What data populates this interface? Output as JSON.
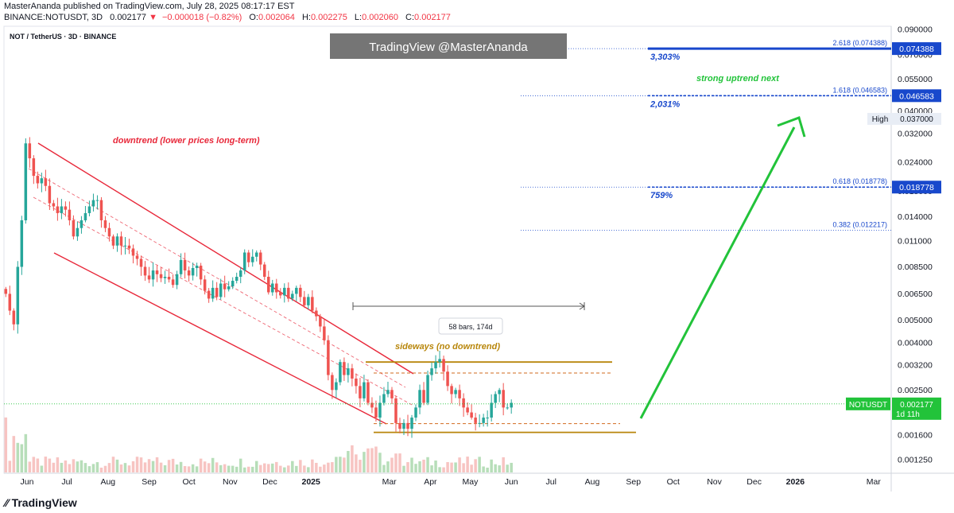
{
  "header": {
    "published": "MasterAnanda published on TradingView.com, July 28, 2025 08:17:17 EST",
    "symbol": "BINANCE:NOTUSDT, 3D",
    "last": "0.002177",
    "change": "−0.000018 (−0.82%)",
    "o_label": "O:",
    "o_value": "0.002064",
    "h_label": "H:",
    "h_value": "0.002275",
    "l_label": "L:",
    "l_value": "0.002060",
    "c_label": "C:",
    "c_value": "0.002177"
  },
  "footer": {
    "brand": "TradingView"
  },
  "colors": {
    "up": "#26a69a",
    "down": "#ef5350",
    "fib": "#1848cc",
    "gold": "#b8860b",
    "green_arrow": "#22c33a",
    "channel": "#e8283a"
  },
  "chart_data": {
    "type": "candlestick",
    "title": "NOT / TetherUS · 3D · BINANCE",
    "watermark": "TradingView @MasterAnanda",
    "y_scale": "log",
    "ylim": [
      0.00113,
      0.09
    ],
    "y_ticks": [
      "0.090000",
      "0.070000",
      "0.055000",
      "0.040000",
      "0.032000",
      "0.024000",
      "0.018000",
      "0.014000",
      "0.011000",
      "0.008500",
      "0.006500",
      "0.005000",
      "0.004000",
      "0.003200",
      "0.002500",
      "0.001600",
      "0.001250"
    ],
    "y_tick_values": [
      0.09,
      0.07,
      0.055,
      0.04,
      0.032,
      0.024,
      0.018,
      0.014,
      0.011,
      0.0085,
      0.0065,
      0.005,
      0.004,
      0.0032,
      0.0025,
      0.0016,
      0.00125
    ],
    "x_ticks": [
      {
        "label": "Jun",
        "date": "2024-06-01",
        "bold": false
      },
      {
        "label": "Jul",
        "date": "2024-07-01",
        "bold": false
      },
      {
        "label": "Aug",
        "date": "2024-08-01",
        "bold": false
      },
      {
        "label": "Sep",
        "date": "2024-09-01",
        "bold": false
      },
      {
        "label": "Oct",
        "date": "2024-10-01",
        "bold": false
      },
      {
        "label": "Nov",
        "date": "2024-11-01",
        "bold": false
      },
      {
        "label": "Dec",
        "date": "2024-12-01",
        "bold": false
      },
      {
        "label": "2025",
        "date": "2025-01-01",
        "bold": true
      },
      {
        "label": "Mar",
        "date": "2025-03-01",
        "bold": false
      },
      {
        "label": "Apr",
        "date": "2025-04-01",
        "bold": false
      },
      {
        "label": "May",
        "date": "2025-05-01",
        "bold": false
      },
      {
        "label": "Jun",
        "date": "2025-06-01",
        "bold": false
      },
      {
        "label": "Jul",
        "date": "2025-07-01",
        "bold": false
      },
      {
        "label": "Aug",
        "date": "2025-08-01",
        "bold": false
      },
      {
        "label": "Sep",
        "date": "2025-09-01",
        "bold": false
      },
      {
        "label": "Oct",
        "date": "2025-10-01",
        "bold": false
      },
      {
        "label": "Nov",
        "date": "2025-11-01",
        "bold": false
      },
      {
        "label": "Dec",
        "date": "2025-12-01",
        "bold": false
      },
      {
        "label": "2026",
        "date": "2026-01-01",
        "bold": true
      },
      {
        "label": "Mar",
        "date": "2026-03-01",
        "bold": false
      }
    ],
    "candles_start": "2024-05-16",
    "candle_interval_days": 3,
    "candles_close": [
      0.0065,
      0.0055,
      0.0048,
      0.0085,
      0.0135,
      0.029,
      0.025,
      0.021,
      0.0195,
      0.0205,
      0.019,
      0.016,
      0.0155,
      0.0145,
      0.0155,
      0.015,
      0.0135,
      0.0115,
      0.0125,
      0.0135,
      0.0145,
      0.0155,
      0.0165,
      0.0165,
      0.0135,
      0.0125,
      0.0115,
      0.0105,
      0.0115,
      0.0105,
      0.0105,
      0.0102,
      0.0095,
      0.0092,
      0.0085,
      0.0078,
      0.0075,
      0.0082,
      0.0079,
      0.0076,
      0.0077,
      0.0075,
      0.0071,
      0.0079,
      0.0091,
      0.0082,
      0.0078,
      0.0084,
      0.0086,
      0.0075,
      0.0067,
      0.0062,
      0.0069,
      0.0063,
      0.0072,
      0.0068,
      0.007,
      0.0074,
      0.0077,
      0.0082,
      0.0098,
      0.0089,
      0.0094,
      0.0098,
      0.0087,
      0.0077,
      0.0066,
      0.0072,
      0.0066,
      0.0064,
      0.0069,
      0.0062,
      0.0065,
      0.0069,
      0.0063,
      0.0058,
      0.0063,
      0.0055,
      0.0052,
      0.0047,
      0.0041,
      0.0029,
      0.0025,
      0.0027,
      0.0033,
      0.0029,
      0.0031,
      0.0028,
      0.0026,
      0.0023,
      0.0027,
      0.0022,
      0.0021,
      0.0019,
      0.0022,
      0.0024,
      0.0025,
      0.0023,
      0.0018,
      0.0017,
      0.0018,
      0.0017,
      0.0019,
      0.0021,
      0.0025,
      0.0022,
      0.0029,
      0.0031,
      0.0033,
      0.0034,
      0.003,
      0.0026,
      0.0024,
      0.0025,
      0.0023,
      0.0021,
      0.002,
      0.0019,
      0.0018,
      0.0018,
      0.0019,
      0.0019,
      0.0022,
      0.0024,
      0.0025,
      0.0021,
      0.0021,
      0.0022
    ],
    "volume_note": "volume histogram at bottom",
    "last_price": {
      "label": "NOTUSDT",
      "value": "0.002177",
      "countdown": "1d 11h"
    },
    "fib_levels": [
      {
        "ratio_label": "2.618 (0.074388)",
        "axis_label": "0.074388",
        "value": 0.074388,
        "pct": "3,303%",
        "highlight": true
      },
      {
        "ratio_label": "1.618 (0.046583)",
        "axis_label": "0.046583",
        "value": 0.046583,
        "pct": "2,031%",
        "highlight": true
      },
      {
        "ratio_label": "0.618 (0.018778)",
        "axis_label": "0.018778",
        "value": 0.018778,
        "pct": "759%",
        "highlight": true
      },
      {
        "ratio_label": "0.382 (0.012217)",
        "axis_label": "",
        "value": 0.012217,
        "pct": "",
        "highlight": false
      }
    ],
    "high_marker": {
      "label": "High",
      "value": "0.037000",
      "price": 0.037
    },
    "annotations": {
      "downtrend": "downtrend (lower prices long-term)",
      "sideways": "sideways (no downtrend)",
      "uptrend": "strong uptrend next",
      "range_measure": "58 bars, 174d"
    },
    "sideways_range": {
      "top": 0.0033,
      "bottom": 0.00164,
      "inner_top": 0.00296,
      "inner_bottom": 0.00179
    },
    "grid": false,
    "legend": "top-left"
  }
}
